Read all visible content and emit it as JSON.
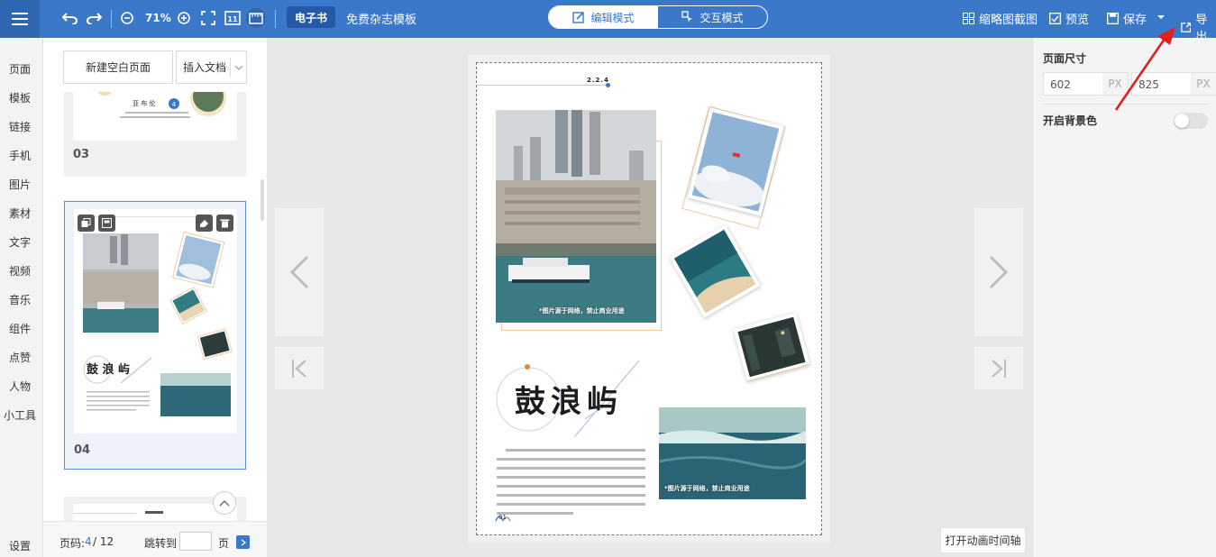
{
  "toolbar": {
    "zoom": "71%",
    "ebook_badge": "电子书",
    "template_title": "免费杂志模板",
    "modes": [
      {
        "label": "编辑模式",
        "active": true
      },
      {
        "label": "交互模式",
        "active": false
      }
    ],
    "right_buttons": {
      "thumbnail": "缩略图截图",
      "preview": "预览",
      "save": "保存",
      "export": "导出"
    },
    "accent_color": "#3a78c9"
  },
  "left_nav": {
    "items": [
      "页面",
      "模板",
      "链接",
      "手机",
      "图片",
      "素材",
      "文字",
      "视频",
      "音乐",
      "组件",
      "点赞",
      "人物",
      "小工具"
    ],
    "settings": "设置"
  },
  "page_panel": {
    "new_blank": "新建空白页面",
    "insert_doc": "插入文档",
    "thumbnails": [
      {
        "number": "03"
      },
      {
        "number": "04",
        "selected": true
      }
    ],
    "pager": {
      "label": "页码:",
      "current": "4",
      "total": "/ 12",
      "jump_label": "跳转到",
      "page_unit": "页"
    }
  },
  "canvas": {
    "page_number_mark": "2.2.4",
    "title": "鼓浪屿",
    "caption_1": "*图片源于网络，禁止商业用途",
    "caption_2": "*图片源于网络，禁止商业用途",
    "footer_number": "01",
    "timeline_button": "打开动画时间轴"
  },
  "right_panel": {
    "page_size_label": "页面尺寸",
    "width": "602",
    "height": "825",
    "unit": "PX",
    "bg_color_label": "开启背景色",
    "bg_color_enabled": false
  }
}
